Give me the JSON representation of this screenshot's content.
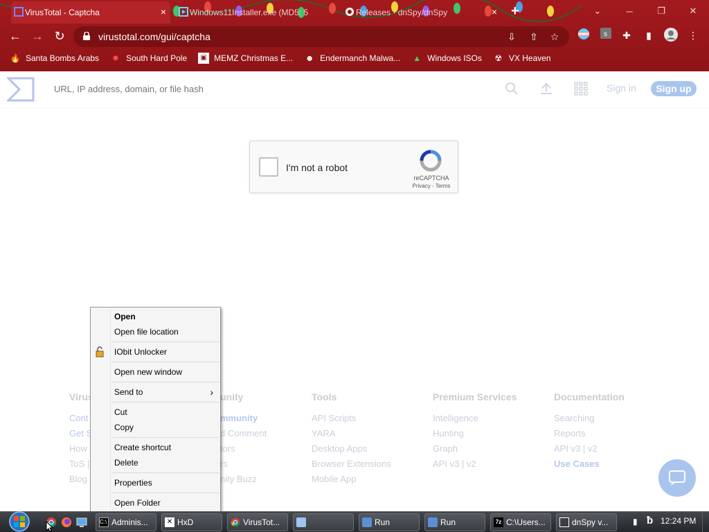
{
  "browser": {
    "tabs": [
      {
        "title": "VirusTotal - Captcha",
        "close": "×",
        "active": true
      },
      {
        "title": "Windows11Installer.exe (MD5: 5",
        "active": false
      },
      {
        "title": "Releases · dnSpy/dnSpy",
        "close": "×",
        "active": false
      }
    ],
    "new_tab": "+",
    "url": "virustotal.com/gui/captcha",
    "bookmarks": [
      {
        "label": "Santa Bombs Arabs",
        "icon": "fire-icon"
      },
      {
        "label": "South Hard Pole",
        "icon": "burst-icon"
      },
      {
        "label": "MEMZ Christmas E...",
        "icon": "window-icon"
      },
      {
        "label": "Endermanch Malwa...",
        "icon": "creature-icon"
      },
      {
        "label": "Windows ISOs",
        "icon": "tree-icon"
      },
      {
        "label": "VX Heaven",
        "icon": "hazard-icon"
      }
    ],
    "accent": "#9a161a"
  },
  "virustotal": {
    "search_placeholder": "URL, IP address, domain, or file hash",
    "signin": "Sign in",
    "signup": "Sign up",
    "captcha": {
      "label": "I'm not a robot",
      "brand": "reCAPTCHA",
      "privacy": "Privacy",
      "dash": " - ",
      "terms": "Terms"
    },
    "footer": [
      {
        "heading": "Virus",
        "links": [
          "Cont",
          "Get S",
          "How",
          "ToS |",
          "Blog"
        ],
        "blue": [
          0,
          1
        ]
      },
      {
        "heading": "unity",
        "links": [
          "mmunity",
          "d Comment",
          "tors",
          "rs",
          "nity Buzz"
        ],
        "blue": [
          0
        ]
      },
      {
        "heading": "Tools",
        "links": [
          "API Scripts",
          "YARA",
          "Desktop Apps",
          "Browser Extensions",
          "Mobile App"
        ],
        "blue": []
      },
      {
        "heading": "Premium Services",
        "links": [
          "Intelligence",
          "Hunting",
          "Graph",
          "API v3 | v2"
        ],
        "blue": []
      },
      {
        "heading": "Documentation",
        "links": [
          "Searching",
          "Reports",
          "API v3 | v2",
          "Use Cases"
        ],
        "blue": [
          3
        ]
      }
    ]
  },
  "context_menu": {
    "items": [
      "Open",
      "Open file location",
      "IObit Unlocker",
      "Open new window",
      "Send to",
      "Cut",
      "Copy",
      "Create shortcut",
      "Delete",
      "Properties",
      "Open Folder"
    ],
    "submenu_arrow": "›"
  },
  "taskbar": {
    "buttons": [
      "Adminis...",
      "HxD",
      "VirusTot...",
      "",
      "Run",
      "Run",
      "C:\\Users...",
      "dnSpy v..."
    ],
    "clock": "12:24 PM"
  }
}
